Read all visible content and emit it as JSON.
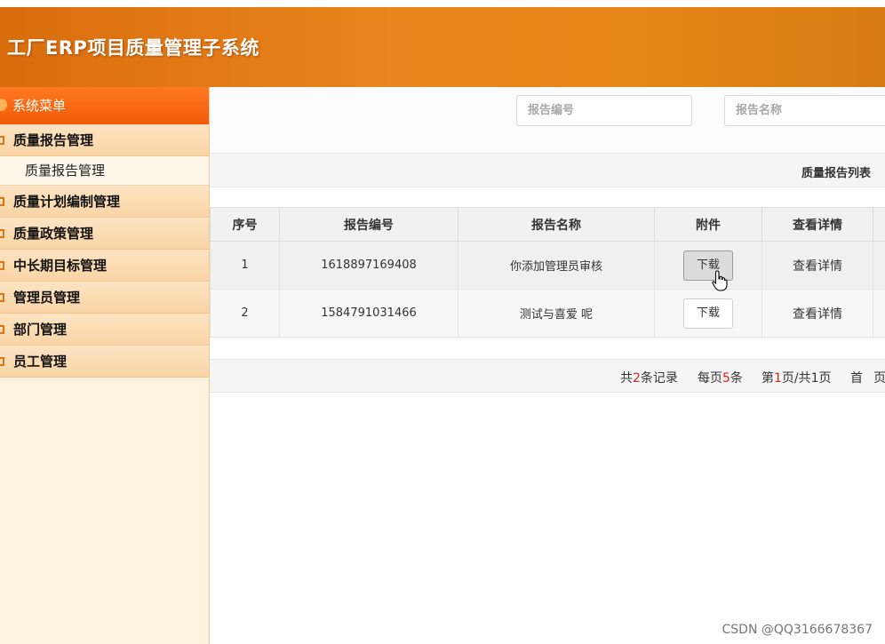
{
  "app": {
    "title": "工厂ERP项目质量管理子系统"
  },
  "sidebar": {
    "heading": "系统菜单",
    "groups": [
      {
        "label": "质量报告管理",
        "items": [
          "质量报告管理"
        ]
      },
      {
        "label": "质量计划编制管理",
        "items": []
      },
      {
        "label": "质量政策管理",
        "items": []
      },
      {
        "label": "中长期目标管理",
        "items": []
      },
      {
        "label": "管理员管理",
        "items": []
      },
      {
        "label": "部门管理",
        "items": []
      },
      {
        "label": "员工管理",
        "items": []
      }
    ]
  },
  "search": {
    "report_no_placeholder": "报告编号",
    "report_name_placeholder": "报告名称"
  },
  "list": {
    "title": "质量报告列表"
  },
  "table": {
    "headers": [
      "序号",
      "报告编号",
      "报告名称",
      "附件",
      "查看详情"
    ],
    "rows": [
      {
        "index": "1",
        "report_no": "1618897169408",
        "report_name": "你添加管理员审核",
        "attachment": "下载",
        "detail": "查看详情"
      },
      {
        "index": "2",
        "report_no": "1584791031466",
        "report_name": "测试与喜爱 呢",
        "attachment": "下载",
        "detail": "查看详情"
      }
    ]
  },
  "pager": {
    "total_prefix": "共",
    "total_count": "2",
    "total_suffix": "条记录",
    "per_page_prefix": "每页",
    "per_page": "5",
    "per_page_suffix": "条",
    "page_prefix": "第",
    "page_current": "1",
    "page_suffix": "页/共1页",
    "first": "首",
    "next_partial": "页"
  },
  "watermark": "CSDN @QQ3166678367",
  "colors": {
    "header": "#e68517",
    "menu_head": "#f15a06",
    "accent_red": "#e2231a"
  }
}
